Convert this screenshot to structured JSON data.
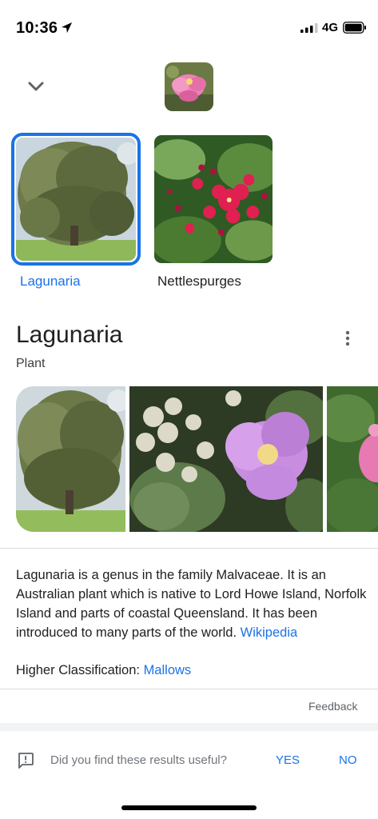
{
  "status_bar": {
    "time": "10:36",
    "network": "4G"
  },
  "results": [
    {
      "label": "Lagunaria",
      "selected": true
    },
    {
      "label": "Nettlespurges",
      "selected": false
    }
  ],
  "entity": {
    "title": "Lagunaria",
    "subtitle": "Plant",
    "description": "Lagunaria is a genus in the family Malvaceae. It is an Australian plant which is native to Lord Howe Island, Norfolk Island and parts of coastal Queensland. It has been introduced to many parts of the world. ",
    "source_link": "Wikipedia",
    "classification_label": "Higher Classification: ",
    "classification_value": "Mallows"
  },
  "feedback_link": "Feedback",
  "feedback_prompt": {
    "question": "Did you find these results useful?",
    "yes": "YES",
    "no": "NO"
  },
  "colors": {
    "accent": "#1a73e8",
    "text_primary": "#202124",
    "text_secondary": "#70757a"
  },
  "icons": {
    "location": "location-arrow-icon",
    "signal": "signal-icon",
    "battery": "battery-icon",
    "collapse": "chevron-down-icon",
    "more": "more-vert-icon",
    "feedback": "feedback-icon"
  }
}
